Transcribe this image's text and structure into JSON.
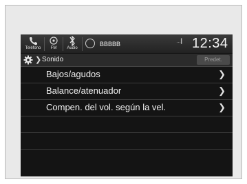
{
  "statusbar": {
    "tabs": [
      {
        "label": "Teléfono",
        "icon": "phone-icon"
      },
      {
        "label": "FM",
        "icon": "radio-icon"
      },
      {
        "label": "Audio",
        "icon": "audio-icon"
      }
    ],
    "station": "BBBBB",
    "signal": "…▎",
    "clock": "12:34"
  },
  "titlebar": {
    "title": "Sonido",
    "default_button": "Predet."
  },
  "menu": {
    "items": [
      {
        "label": "Bajos/agudos"
      },
      {
        "label": "Balance/atenuador"
      },
      {
        "label": "Compen. del vol. según la vel."
      }
    ]
  }
}
